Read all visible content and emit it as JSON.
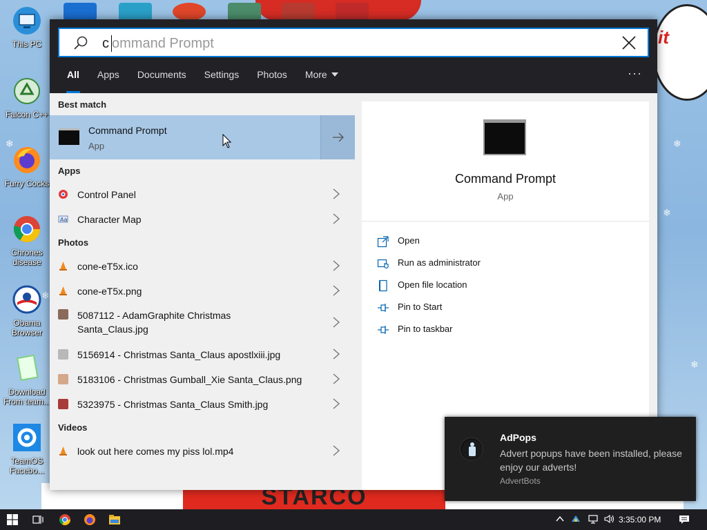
{
  "desktop": {
    "icons": [
      {
        "label": "This PC"
      },
      {
        "label": "Falcon C++"
      },
      {
        "label": "Furry Cocks"
      },
      {
        "label": "Chrones disease"
      },
      {
        "label": "Obama Browser"
      },
      {
        "label": "Download From team..."
      },
      {
        "label": "TeamOS Facebo..."
      }
    ],
    "wallpaper_text": "STARCO",
    "bubble_text": "it"
  },
  "search": {
    "typed": "c",
    "suggestion": "ommand Prompt",
    "tabs": [
      {
        "label": "All",
        "active": true
      },
      {
        "label": "Apps"
      },
      {
        "label": "Documents"
      },
      {
        "label": "Settings"
      },
      {
        "label": "Photos"
      },
      {
        "label": "More"
      }
    ],
    "more_options": "···"
  },
  "results": {
    "best_match_header": "Best match",
    "best_match": {
      "title": "Command Prompt",
      "subtitle": "App"
    },
    "apps_header": "Apps",
    "apps": [
      {
        "label": "Control Panel",
        "icon": "control-panel-icon"
      },
      {
        "label": "Character Map",
        "icon": "character-map-icon"
      }
    ],
    "photos_header": "Photos",
    "photos": [
      {
        "label": "cone-eT5x.ico"
      },
      {
        "label": "cone-eT5x.png"
      },
      {
        "label": "5087112 - AdamGraphite Christmas Santa_Claus.jpg"
      },
      {
        "label": "5156914 - Christmas Santa_Claus apostlxiii.jpg"
      },
      {
        "label": "5183106 - Christmas Gumball_Xie Santa_Claus.png"
      },
      {
        "label": "5323975 - Christmas Santa_Claus Smith.jpg"
      }
    ],
    "videos_header": "Videos",
    "videos": [
      {
        "label": "look out here comes my piss lol.mp4"
      }
    ]
  },
  "preview": {
    "name": "Command Prompt",
    "type": "App",
    "actions": [
      {
        "label": "Open",
        "icon": "open-icon"
      },
      {
        "label": "Run as administrator",
        "icon": "shield-icon"
      },
      {
        "label": "Open file location",
        "icon": "file-location-icon"
      },
      {
        "label": "Pin to Start",
        "icon": "pin-icon"
      },
      {
        "label": "Pin to taskbar",
        "icon": "pin-icon"
      }
    ]
  },
  "toast": {
    "title": "AdPops",
    "body": "Advert popups have been installed, please enjoy our adverts!",
    "source": "AdvertBots"
  },
  "taskbar": {
    "clock": "3:35:00 PM"
  },
  "colors": {
    "accent": "#0078d7",
    "panel_header": "#222226",
    "best_match_bg": "#a8c8e6",
    "toast_bg": "#1f1f1f"
  }
}
